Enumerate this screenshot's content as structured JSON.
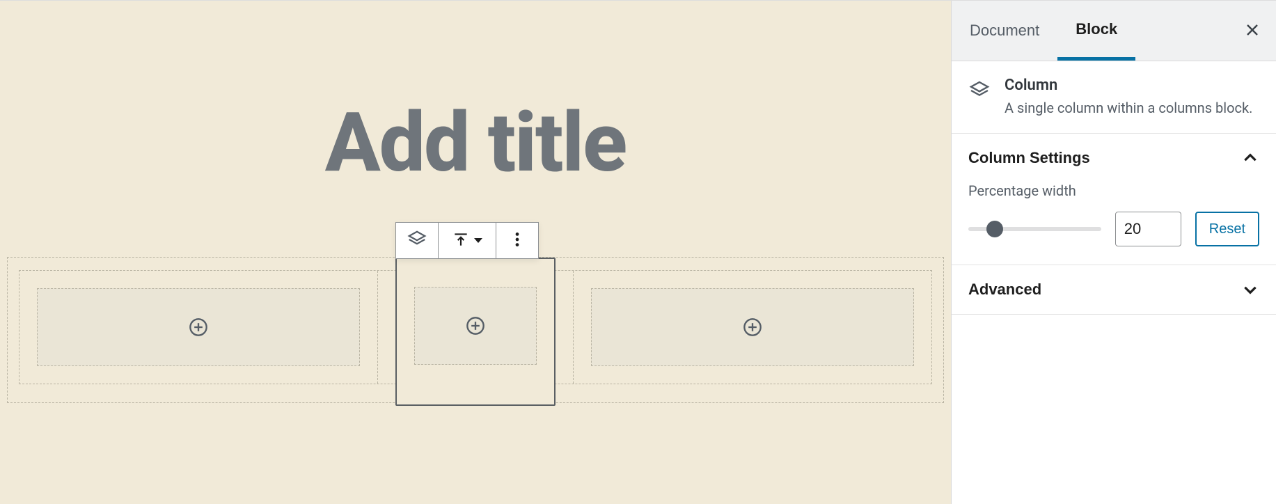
{
  "editor": {
    "title_placeholder": "Add title"
  },
  "sidebar": {
    "tabs": {
      "document": "Document",
      "block": "Block",
      "active": "block"
    },
    "block_card": {
      "title": "Column",
      "description": "A single column within a columns block."
    },
    "column_settings": {
      "title": "Column Settings",
      "percentage_label": "Percentage width",
      "percentage_value": "20",
      "reset_label": "Reset"
    },
    "advanced": {
      "title": "Advanced"
    }
  }
}
